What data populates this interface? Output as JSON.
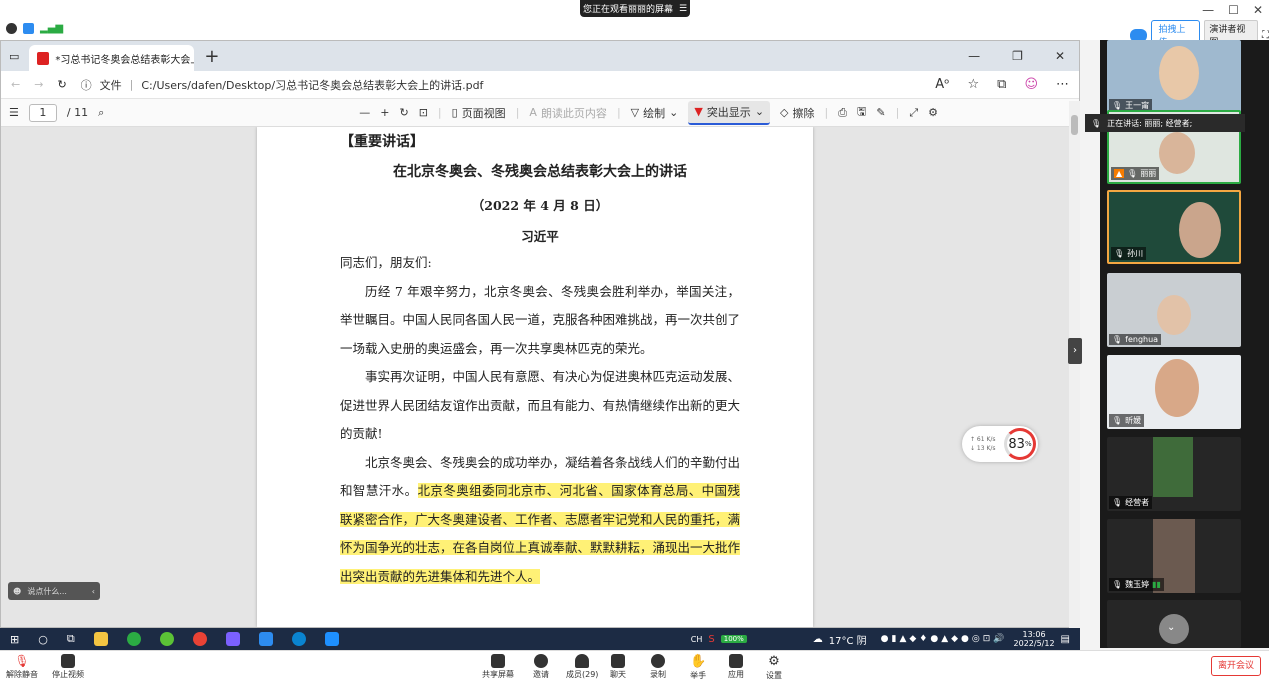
{
  "zoom": {
    "share_banner": "您正在观看丽丽的屏幕",
    "view_label": "演讲者视图",
    "upload_label": "拍拽上传",
    "window_controls": [
      "—",
      "☐",
      "✕"
    ],
    "speaking_now": "正在讲话: 丽丽; 经营者;",
    "leave_label": "离开会议",
    "toolbar": {
      "mute": "解除静音",
      "video": "停止视频",
      "share": "共享屏幕",
      "invite": "邀请",
      "members": "成员(29)",
      "chat": "聊天",
      "record": "录制",
      "raise_hand": "举手",
      "apps": "应用",
      "settings": "设置"
    },
    "chat_placeholder": "说点什么...",
    "participants": [
      {
        "name": "王一甯"
      },
      {
        "name": "丽丽"
      },
      {
        "name": "孙川"
      },
      {
        "name": "fenghua"
      },
      {
        "name": "昕媛"
      },
      {
        "name": "经营者"
      },
      {
        "name": "魏玉婷"
      }
    ]
  },
  "browser": {
    "tab_title": "*习总书记冬奥会总结表彰大会上",
    "address_label": "文件",
    "address": "C:/Users/dafen/Desktop/习总书记冬奥会总结表彰大会上的讲话.pdf",
    "pdf_toolbar": {
      "page_current": "1",
      "page_total": "/ 11",
      "page_view": "页面视图",
      "read_aloud": "朗读此页内容",
      "draw": "绘制",
      "highlight": "突出显示",
      "erase": "擦除"
    }
  },
  "document": {
    "kicker": "【重要讲话】",
    "title": "在北京冬奥会、冬残奥会总结表彰大会上的讲话",
    "date": "（2022 年 4 月 8 日）",
    "author": "习近平",
    "salutation": "同志们，朋友们:",
    "para1": "历经 7 年艰辛努力，北京冬奥会、冬残奥会胜利举办，举国关注，举世瞩目。中国人民同各国人民一道，克服各种困难挑战，再一次共创了一场载入史册的奥运盛会，再一次共享奥林匹克的荣光。",
    "para2": "事实再次证明，中国人民有意愿、有决心为促进奥林匹克运动发展、促进世界人民团结友谊作出贡献，而且有能力、有热情继续作出新的更大的贡献!",
    "para3_plain": "北京冬奥会、冬残奥会的成功举办，凝结着各条战线人们的辛勤付出和智慧汗水。",
    "para3_highlight": "北京冬奥组委同北京市、河北省、国家体育总局、中国残联紧密合作，广大冬奥建设者、工作者、志愿者牢记党和人民的重托，满怀为国争光的壮志，在各自岗位上真诚奉献、默默耕耘，涌现出一大批作出突出贡献的先进集体和先进个人。"
  },
  "network": {
    "up": "↑ 61 K/s",
    "down": "↓ 13 K/s",
    "percent": "83",
    "unit": "%"
  },
  "taskbar": {
    "ime": "CH",
    "battery": "100%",
    "weather": "17°C 阴",
    "time": "13:06",
    "date": "2022/5/12"
  },
  "colors": {
    "highlight": "#fff176",
    "accent": "#2a5bd7",
    "danger": "#e53935"
  }
}
